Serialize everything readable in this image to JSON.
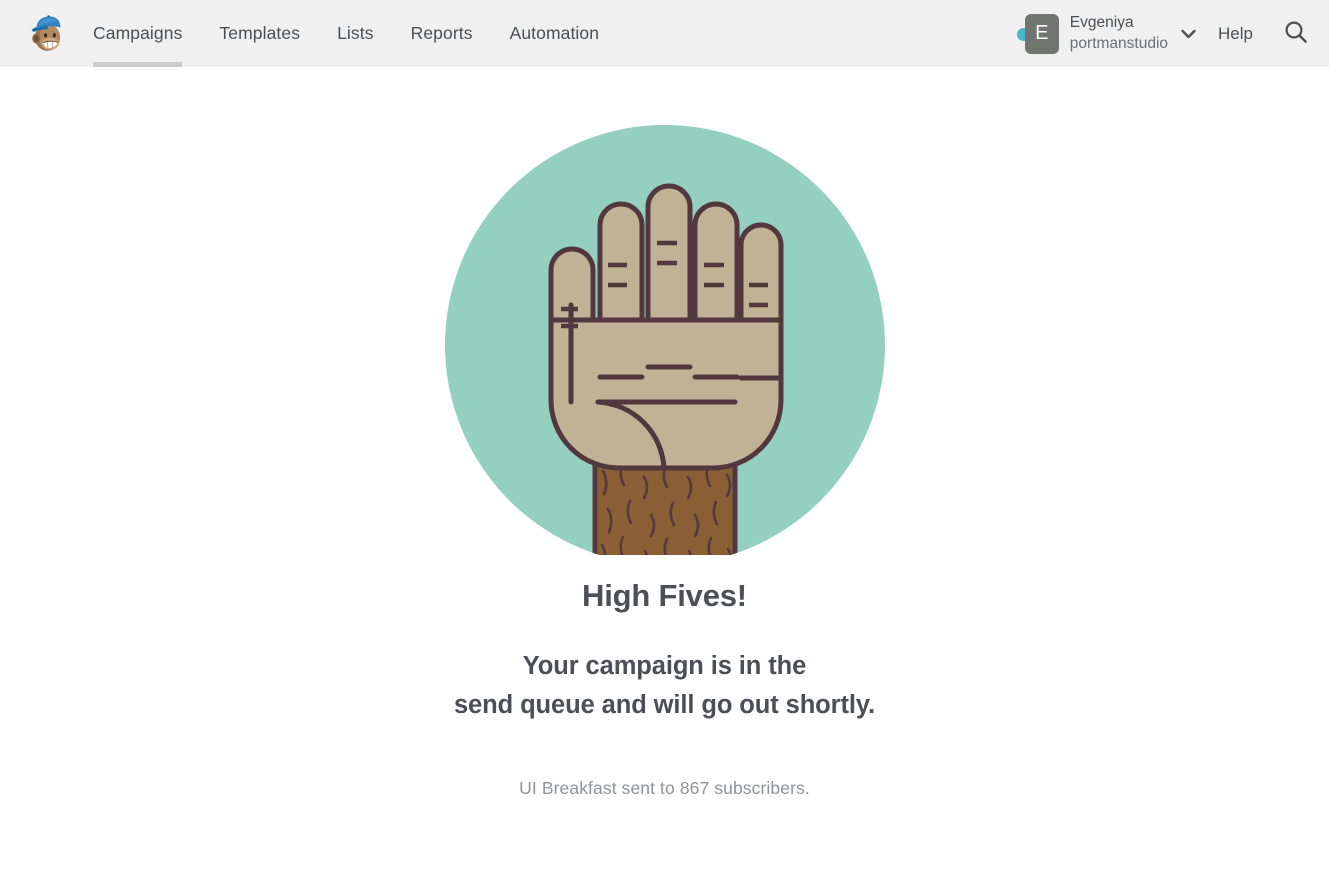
{
  "brand": {
    "logo_icon": "freddie-mailchimp-logo",
    "cap_color": "#2b7dbd",
    "face_color": "#a77e58"
  },
  "nav": {
    "items": [
      {
        "label": "Campaigns",
        "active": true
      },
      {
        "label": "Templates",
        "active": false
      },
      {
        "label": "Lists",
        "active": false
      },
      {
        "label": "Reports",
        "active": false
      },
      {
        "label": "Automation",
        "active": false
      }
    ],
    "active_indicator_color": "#cccccc"
  },
  "account": {
    "avatar_initial": "E",
    "avatar_bg": "#72756f",
    "status_dot_color": "#4cb8d4",
    "user_name": "Evgeniya",
    "org_name": "portmanstudio",
    "dropdown_icon": "chevron-down-icon"
  },
  "help": {
    "label": "Help"
  },
  "search": {
    "icon": "search-icon"
  },
  "main": {
    "illustration": {
      "name": "high-five-hand-illustration",
      "circle_color": "#93d0bf",
      "hand_color": "#c2b295",
      "arm_color": "#8a5f35",
      "outline_color": "#53373f"
    },
    "headline": "High Fives!",
    "subhead_line_1": "Your campaign is in the",
    "subhead_line_2": "send queue and will go out shortly.",
    "meta": "UI Breakfast sent to 867 subscribers.",
    "campaign_name": "UI Breakfast",
    "subscriber_count": "867"
  },
  "colors": {
    "header_bg": "#f0f0f0",
    "page_bg": "#ffffff",
    "text_primary": "#4a5056",
    "text_muted": "#8e9499"
  }
}
